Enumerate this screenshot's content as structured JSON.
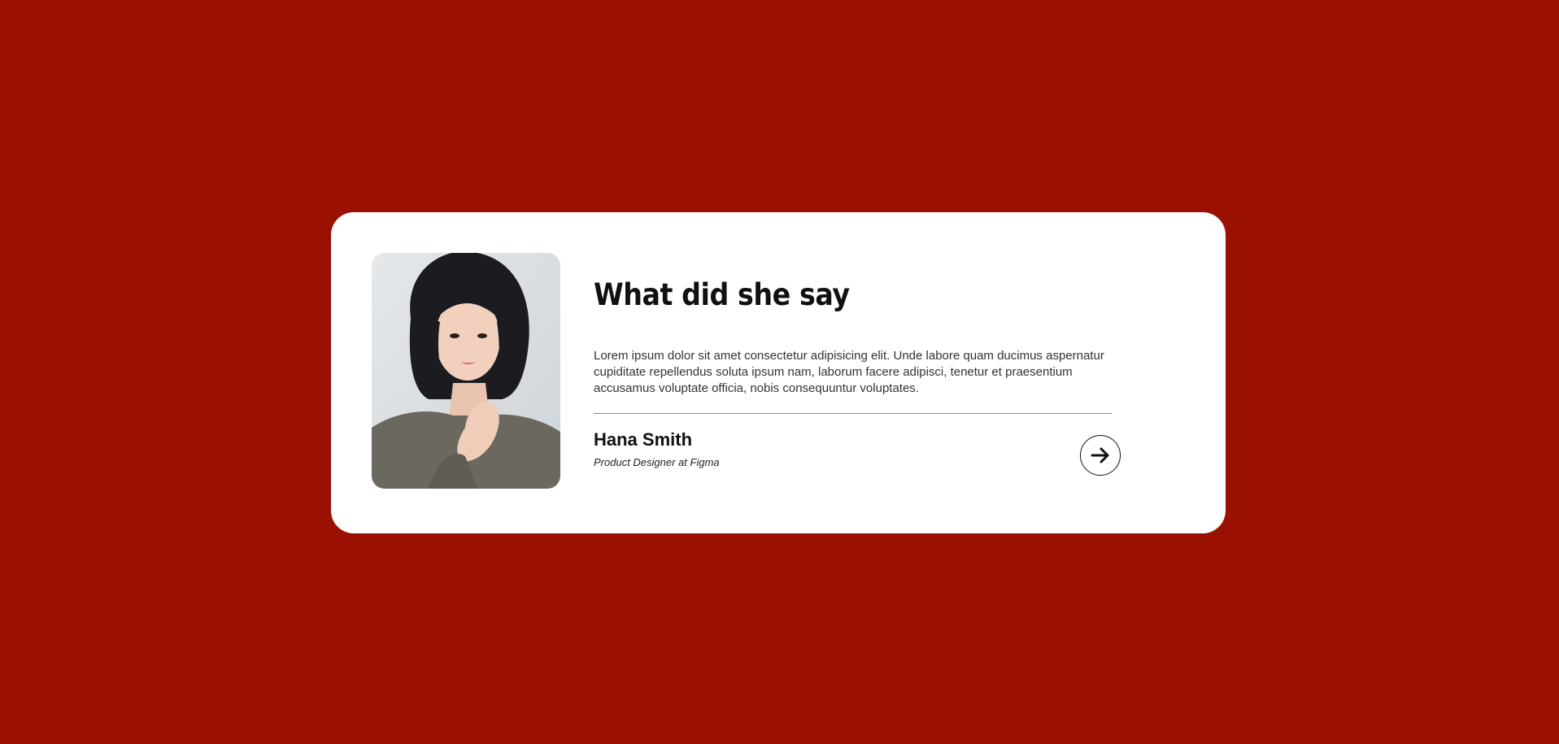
{
  "testimonial": {
    "heading": "What did she say",
    "quote": "Lorem ipsum dolor sit amet consectetur adipisicing elit. Unde labore quam ducimus aspernatur cupiditate repellendus soluta ipsum nam, laborum facere adipisci, tenetur et praesentium accusamus voluptate officia, nobis consequuntur voluptates.",
    "author_name": "Hana Smith",
    "author_role": "Product Designer at Figma",
    "next_icon": "arrow-right-icon"
  },
  "colors": {
    "background": "#9a1002",
    "card": "#ffffff",
    "text": "#111111"
  }
}
